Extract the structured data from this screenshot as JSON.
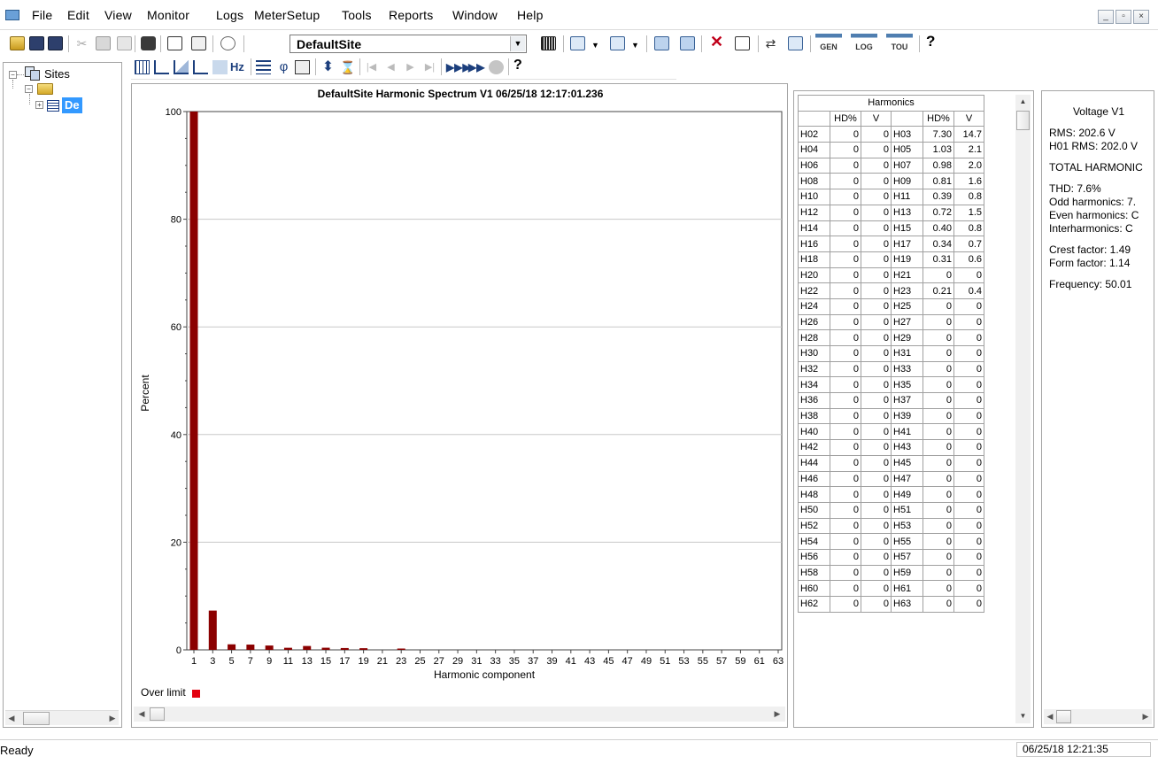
{
  "menu": [
    "File",
    "Edit",
    "View",
    "Monitor",
    "Logs",
    "MeterSetup",
    "Tools",
    "Reports",
    "Window",
    "Help"
  ],
  "toolbar": {
    "site_combo_value": "DefaultSite",
    "gen_label": "GEN",
    "log_label": "LOG",
    "tou_label": "TOU",
    "help_glyph": "?",
    "hz_label": "Hz"
  },
  "tree": {
    "root_label": "Sites",
    "device_label": "De"
  },
  "chart": {
    "title": "DefaultSite  Harmonic Spectrum V1  06/25/18  12:17:01.236",
    "legend": "Over limit"
  },
  "chart_data": {
    "type": "bar",
    "title": "DefaultSite  Harmonic Spectrum V1  06/25/18  12:17:01.236",
    "xlabel": "Harmonic component",
    "ylabel": "Percent",
    "ylim": [
      0,
      100
    ],
    "yticks": [
      0,
      20,
      40,
      60,
      80,
      100
    ],
    "grid": true,
    "bar_color": "#8b0000",
    "over_limit_color": "#e3000f",
    "x_tick_labels": [
      "1",
      "3",
      "5",
      "7",
      "9",
      "11",
      "13",
      "15",
      "17",
      "19",
      "21",
      "23",
      "25",
      "27",
      "29",
      "31",
      "33",
      "35",
      "37",
      "39",
      "41",
      "43",
      "45",
      "47",
      "49",
      "51",
      "53",
      "55",
      "57",
      "59",
      "61",
      "63"
    ],
    "categories": [
      1,
      3,
      5,
      7,
      9,
      11,
      13,
      15,
      17,
      19,
      21,
      23
    ],
    "values": [
      100,
      7.3,
      1.03,
      0.98,
      0.81,
      0.39,
      0.72,
      0.4,
      0.34,
      0.31,
      0,
      0.21
    ]
  },
  "harmonics": {
    "title": "Harmonics",
    "headers": [
      "HD%",
      "V",
      "HD%",
      "V"
    ],
    "rows": [
      [
        "H02",
        "0",
        "0",
        "H03",
        "7.30",
        "14.7"
      ],
      [
        "H04",
        "0",
        "0",
        "H05",
        "1.03",
        "2.1"
      ],
      [
        "H06",
        "0",
        "0",
        "H07",
        "0.98",
        "2.0"
      ],
      [
        "H08",
        "0",
        "0",
        "H09",
        "0.81",
        "1.6"
      ],
      [
        "H10",
        "0",
        "0",
        "H11",
        "0.39",
        "0.8"
      ],
      [
        "H12",
        "0",
        "0",
        "H13",
        "0.72",
        "1.5"
      ],
      [
        "H14",
        "0",
        "0",
        "H15",
        "0.40",
        "0.8"
      ],
      [
        "H16",
        "0",
        "0",
        "H17",
        "0.34",
        "0.7"
      ],
      [
        "H18",
        "0",
        "0",
        "H19",
        "0.31",
        "0.6"
      ],
      [
        "H20",
        "0",
        "0",
        "H21",
        "0",
        "0"
      ],
      [
        "H22",
        "0",
        "0",
        "H23",
        "0.21",
        "0.4"
      ],
      [
        "H24",
        "0",
        "0",
        "H25",
        "0",
        "0"
      ],
      [
        "H26",
        "0",
        "0",
        "H27",
        "0",
        "0"
      ],
      [
        "H28",
        "0",
        "0",
        "H29",
        "0",
        "0"
      ],
      [
        "H30",
        "0",
        "0",
        "H31",
        "0",
        "0"
      ],
      [
        "H32",
        "0",
        "0",
        "H33",
        "0",
        "0"
      ],
      [
        "H34",
        "0",
        "0",
        "H35",
        "0",
        "0"
      ],
      [
        "H36",
        "0",
        "0",
        "H37",
        "0",
        "0"
      ],
      [
        "H38",
        "0",
        "0",
        "H39",
        "0",
        "0"
      ],
      [
        "H40",
        "0",
        "0",
        "H41",
        "0",
        "0"
      ],
      [
        "H42",
        "0",
        "0",
        "H43",
        "0",
        "0"
      ],
      [
        "H44",
        "0",
        "0",
        "H45",
        "0",
        "0"
      ],
      [
        "H46",
        "0",
        "0",
        "H47",
        "0",
        "0"
      ],
      [
        "H48",
        "0",
        "0",
        "H49",
        "0",
        "0"
      ],
      [
        "H50",
        "0",
        "0",
        "H51",
        "0",
        "0"
      ],
      [
        "H52",
        "0",
        "0",
        "H53",
        "0",
        "0"
      ],
      [
        "H54",
        "0",
        "0",
        "H55",
        "0",
        "0"
      ],
      [
        "H56",
        "0",
        "0",
        "H57",
        "0",
        "0"
      ],
      [
        "H58",
        "0",
        "0",
        "H59",
        "0",
        "0"
      ],
      [
        "H60",
        "0",
        "0",
        "H61",
        "0",
        "0"
      ],
      [
        "H62",
        "0",
        "0",
        "H63",
        "0",
        "0"
      ]
    ]
  },
  "info": {
    "title": "Voltage V1",
    "lines": [
      "RMS: 202.6 V",
      "H01 RMS: 202.0 V",
      "",
      "TOTAL HARMONIC",
      "",
      "THD: 7.6%",
      "Odd harmonics: 7.",
      "Even harmonics: C",
      "Interharmonics: C",
      "",
      "Crest factor: 1.49",
      "Form factor: 1.14",
      "",
      "Frequency: 50.01"
    ]
  },
  "status": {
    "text": "Ready",
    "time": "06/25/18 12:21:35"
  },
  "icons": {
    "open": "folder-open-icon",
    "save": "save-icon",
    "print": "print-icon",
    "close": "delete-icon",
    "help": "help-icon"
  }
}
